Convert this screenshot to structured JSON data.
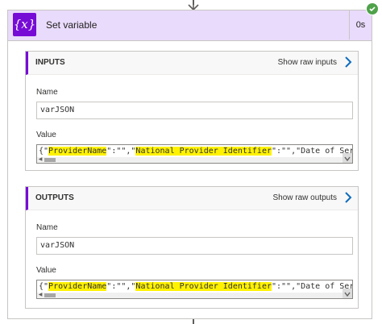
{
  "card": {
    "icon_glyph": "{x}",
    "title": "Set variable",
    "duration": "0s",
    "status_color": "#4fa24a",
    "accent_color": "#770bd6"
  },
  "inputs": {
    "header": "INPUTS",
    "raw_link": "Show raw inputs",
    "name_label": "Name",
    "name_value": "varJSON",
    "value_label": "Value",
    "value_parts": [
      "{\"",
      "ProviderName",
      "\":\"\",\"",
      "National Provider Identifier",
      "\":\"\",\"Date of Ser"
    ]
  },
  "outputs": {
    "header": "OUTPUTS",
    "raw_link": "Show raw outputs",
    "name_label": "Name",
    "name_value": "varJSON",
    "value_label": "Value",
    "value_parts": [
      "{\"",
      "ProviderName",
      "\":\"\",\"",
      "National Provider Identifier",
      "\":\"\",\"Date of Ser"
    ]
  }
}
